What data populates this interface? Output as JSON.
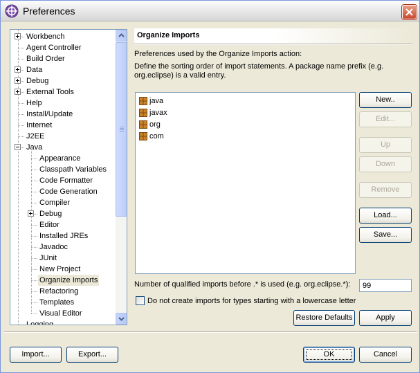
{
  "window": {
    "title": "Preferences"
  },
  "tree": {
    "items": [
      {
        "label": "Workbench",
        "level": 0,
        "expander": "plus"
      },
      {
        "label": "Agent Controller",
        "level": 0
      },
      {
        "label": "Build Order",
        "level": 0
      },
      {
        "label": "Data",
        "level": 0,
        "expander": "plus"
      },
      {
        "label": "Debug",
        "level": 0,
        "expander": "plus"
      },
      {
        "label": "External Tools",
        "level": 0,
        "expander": "plus"
      },
      {
        "label": "Help",
        "level": 0
      },
      {
        "label": "Install/Update",
        "level": 0
      },
      {
        "label": "Internet",
        "level": 0
      },
      {
        "label": "J2EE",
        "level": 0
      },
      {
        "label": "Java",
        "level": 0,
        "expander": "minus"
      },
      {
        "label": "Appearance",
        "level": 1
      },
      {
        "label": "Classpath Variables",
        "level": 1
      },
      {
        "label": "Code Formatter",
        "level": 1
      },
      {
        "label": "Code Generation",
        "level": 1
      },
      {
        "label": "Compiler",
        "level": 1
      },
      {
        "label": "Debug",
        "level": 1,
        "expander": "plus"
      },
      {
        "label": "Editor",
        "level": 1
      },
      {
        "label": "Installed JREs",
        "level": 1
      },
      {
        "label": "Javadoc",
        "level": 1
      },
      {
        "label": "JUnit",
        "level": 1
      },
      {
        "label": "New Project",
        "level": 1
      },
      {
        "label": "Organize Imports",
        "level": 1,
        "selected": true
      },
      {
        "label": "Refactoring",
        "level": 1
      },
      {
        "label": "Templates",
        "level": 1
      },
      {
        "label": "Visual Editor",
        "level": 1
      },
      {
        "label": "Logging",
        "level": 0
      }
    ]
  },
  "panel": {
    "title": "Organize Imports",
    "description_line1": "Preferences used by the Organize Imports action:",
    "description_line2": "Define the sorting order of import statements. A package name prefix (e.g.",
    "description_line3": "org.eclipse) is a valid entry.",
    "imports": [
      "java",
      "javax",
      "org",
      "com"
    ],
    "buttons": {
      "new": "New..",
      "edit": "Edit...",
      "up": "Up",
      "down": "Down",
      "remove": "Remove",
      "load": "Load...",
      "save": "Save..."
    },
    "qualified_label": "Number of qualified imports before .* is used (e.g. org.eclipse.*):",
    "qualified_value": "99",
    "lowercase_label": "Do not create imports for types starting with a lowercase letter",
    "lowercase_checked": false,
    "restore_defaults": "Restore Defaults",
    "apply": "Apply"
  },
  "footer": {
    "import": "Import...",
    "export": "Export...",
    "ok": "OK",
    "cancel": "Cancel"
  },
  "colors": {
    "accent": "#003c74",
    "close": "#c9482c",
    "package_icon": "#c9822b"
  }
}
